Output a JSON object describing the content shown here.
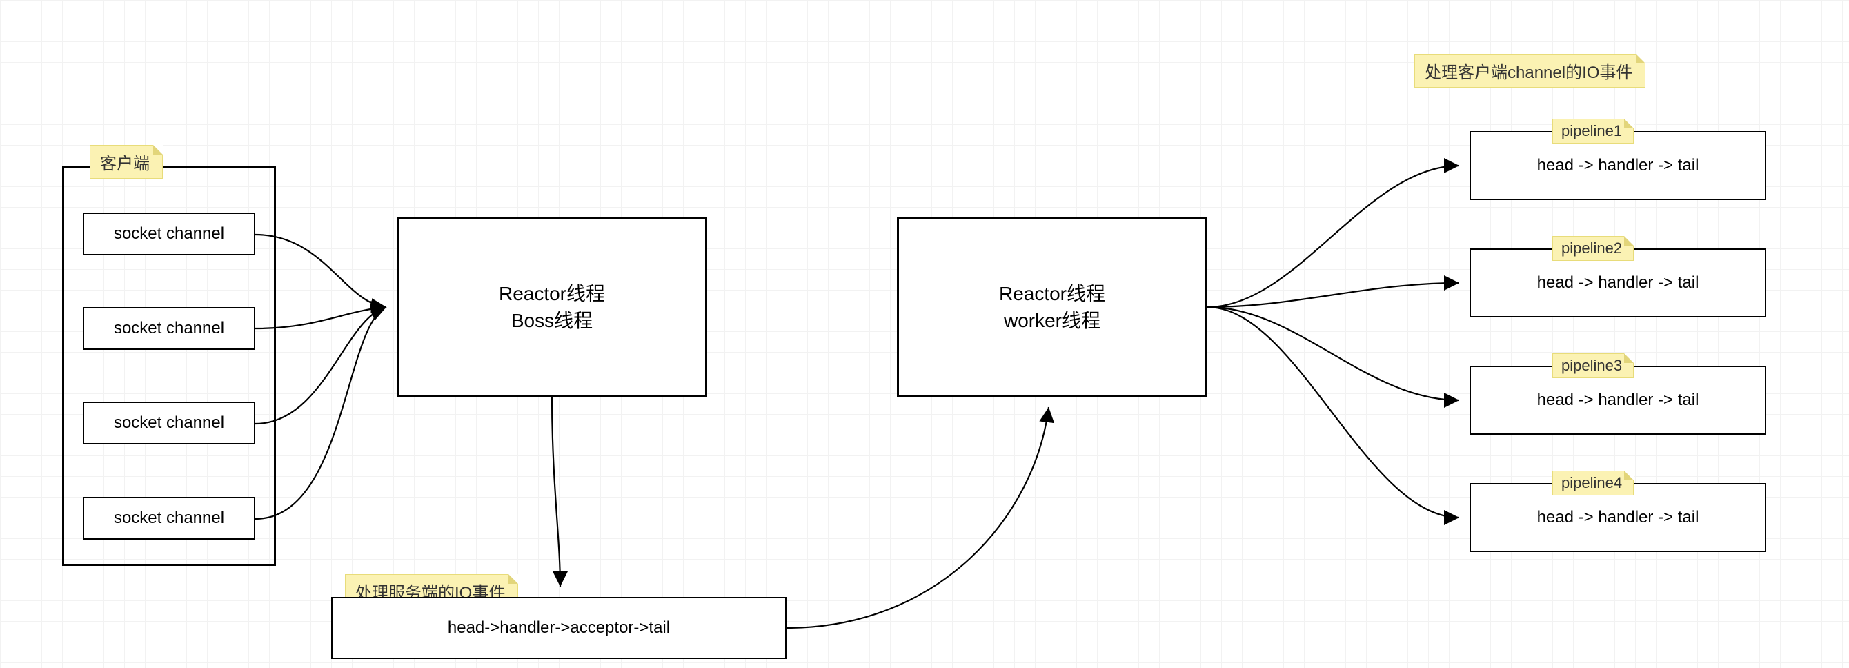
{
  "clients": {
    "label": "客户端",
    "sockets": [
      "socket channel",
      "socket channel",
      "socket channel",
      "socket channel"
    ]
  },
  "boss": {
    "line1": "Reactor线程",
    "line2": "Boss线程"
  },
  "serverPipeline": {
    "label": "处理服务端的IO事件",
    "content": "head->handler->acceptor->tail"
  },
  "worker": {
    "line1": "Reactor线程",
    "line2": "worker线程"
  },
  "clientIO": {
    "label": "处理客户端channel的IO事件",
    "pipelines": [
      {
        "name": "pipeline1",
        "content": "head -> handler -> tail"
      },
      {
        "name": "pipeline2",
        "content": "head -> handler -> tail"
      },
      {
        "name": "pipeline3",
        "content": "head -> handler -> tail"
      },
      {
        "name": "pipeline4",
        "content": "head -> handler -> tail"
      }
    ]
  }
}
